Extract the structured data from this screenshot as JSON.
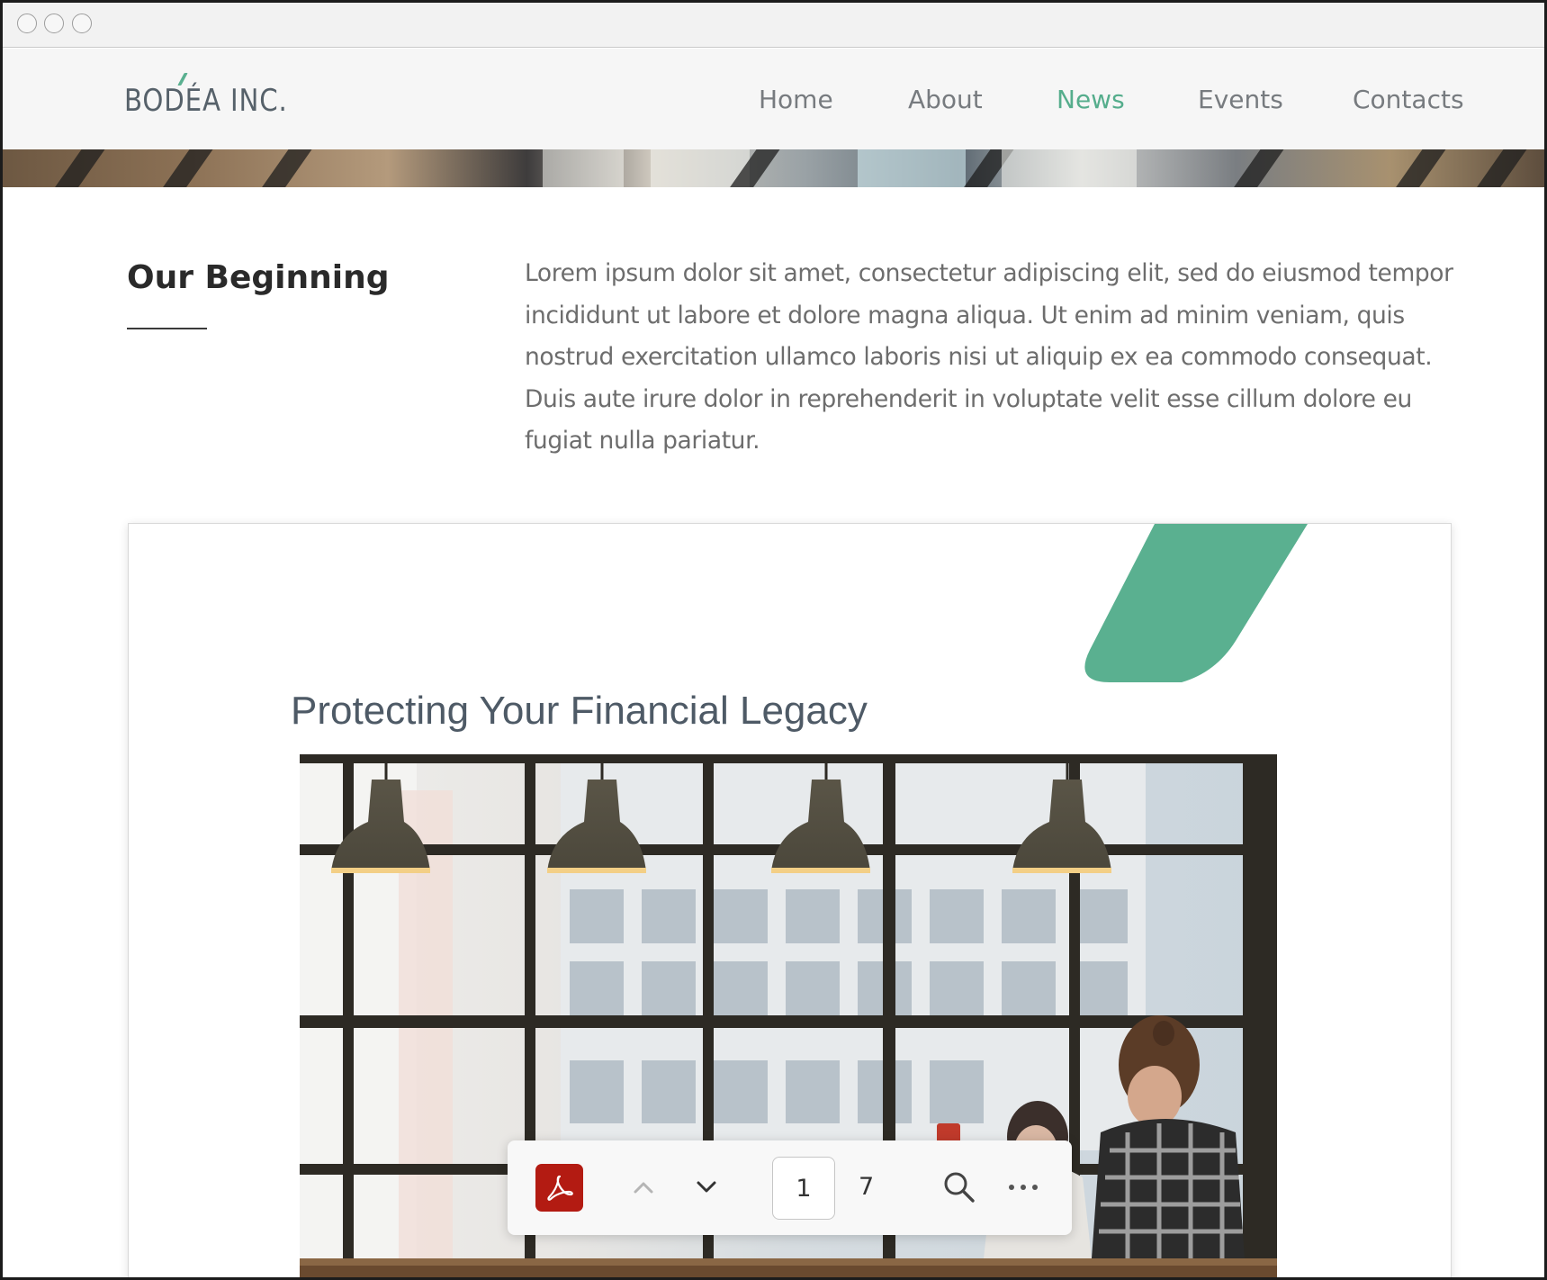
{
  "site": {
    "logo": "BODÉA INC.",
    "nav": [
      {
        "label": "Home",
        "active": false
      },
      {
        "label": "About",
        "active": false
      },
      {
        "label": "News",
        "active": true
      },
      {
        "label": "Events",
        "active": false
      },
      {
        "label": "Contacts",
        "active": false
      }
    ],
    "accent_color": "#55ad8c"
  },
  "section": {
    "title": "Our Beginning",
    "body": "Lorem ipsum dolor sit amet, consectetur adipiscing elit, sed do eiusmod tempor incididunt ut labore et dolore magna aliqua. Ut enim ad minim veniam, quis nostrud exercitation ullamco laboris nisi ut aliquip ex ea commodo consequat. Duis aute irure dolor in reprehenderit in voluptate velit esse cillum dolore eu fugiat nulla pariatur."
  },
  "document": {
    "title": "Protecting Your Financial Legacy",
    "image": "office-window-photo"
  },
  "pdf_toolbar": {
    "app_icon": "acrobat-icon",
    "current_page": "1",
    "total_pages": "7",
    "icons": [
      "chevron-up-icon",
      "chevron-down-icon",
      "search-icon",
      "more-icon"
    ],
    "brand_color": "#b31b12"
  }
}
